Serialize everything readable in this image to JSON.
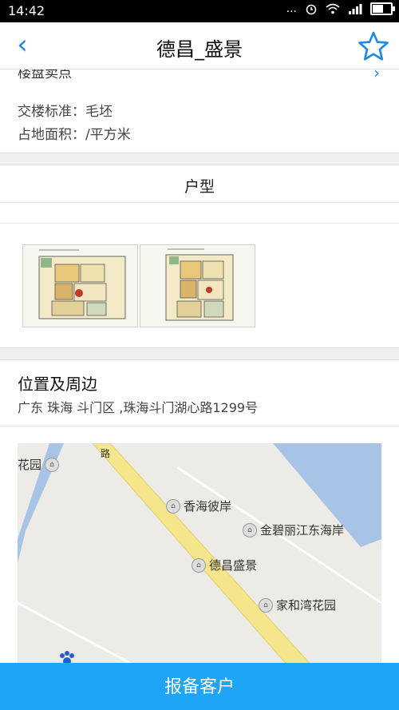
{
  "status_bar": {
    "time": "14:42",
    "signal_text": "..."
  },
  "nav": {
    "back_icon": "‹",
    "title": "德昌_盛景",
    "favorite_icon": "star-outline-icon"
  },
  "details": {
    "partial_label": "楼盘卖点",
    "delivery_standard": "交楼标准：毛坯",
    "land_area": "占地面积：/平方米"
  },
  "floorplan": {
    "section_title": "户型",
    "thumbnails": [
      "floorplan-1",
      "floorplan-2"
    ]
  },
  "location": {
    "title": "位置及周边",
    "address": "广东 珠海 斗门区 ,珠海斗门湖心路1299号",
    "map_labels": [
      "花园",
      "香海彼岸",
      "金碧丽江东海岸",
      "德昌盛景",
      "家和湾花园"
    ],
    "road_label": "路"
  },
  "bottom_action": {
    "label": "报备客户"
  },
  "colors": {
    "accent": "#1ea5f5",
    "link": "#1e88e5"
  }
}
